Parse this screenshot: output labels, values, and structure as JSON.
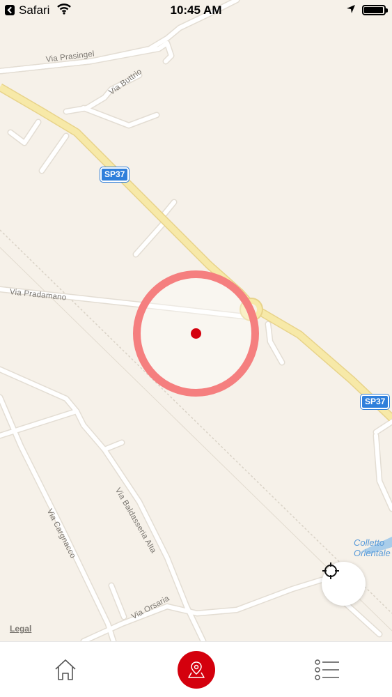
{
  "status_bar": {
    "back_app": "Safari",
    "time": "10:45 AM",
    "icons": [
      "back-icon",
      "wifi-icon",
      "location-arrow-icon",
      "battery-icon"
    ]
  },
  "map": {
    "streets": [
      "Via Prasingel",
      "Via Buttrio",
      "Via Pradamano",
      "Via Cargnacco",
      "Via Baldasseria Alta",
      "Via Orsaria"
    ],
    "road_shields": [
      "SP37",
      "SP37"
    ],
    "water_label": "Colletto\nOrientale",
    "legal": "Legal",
    "geofence_color": "#f57f7f",
    "pin_color": "#d4000d",
    "icons": [
      "crosshair-icon"
    ]
  },
  "tab_bar": {
    "accent": "#d4000d",
    "tabs": [
      {
        "name": "home",
        "icon": "home-icon"
      },
      {
        "name": "map",
        "icon": "map-pin-icon",
        "active": true
      },
      {
        "name": "list",
        "icon": "list-icon"
      }
    ]
  }
}
